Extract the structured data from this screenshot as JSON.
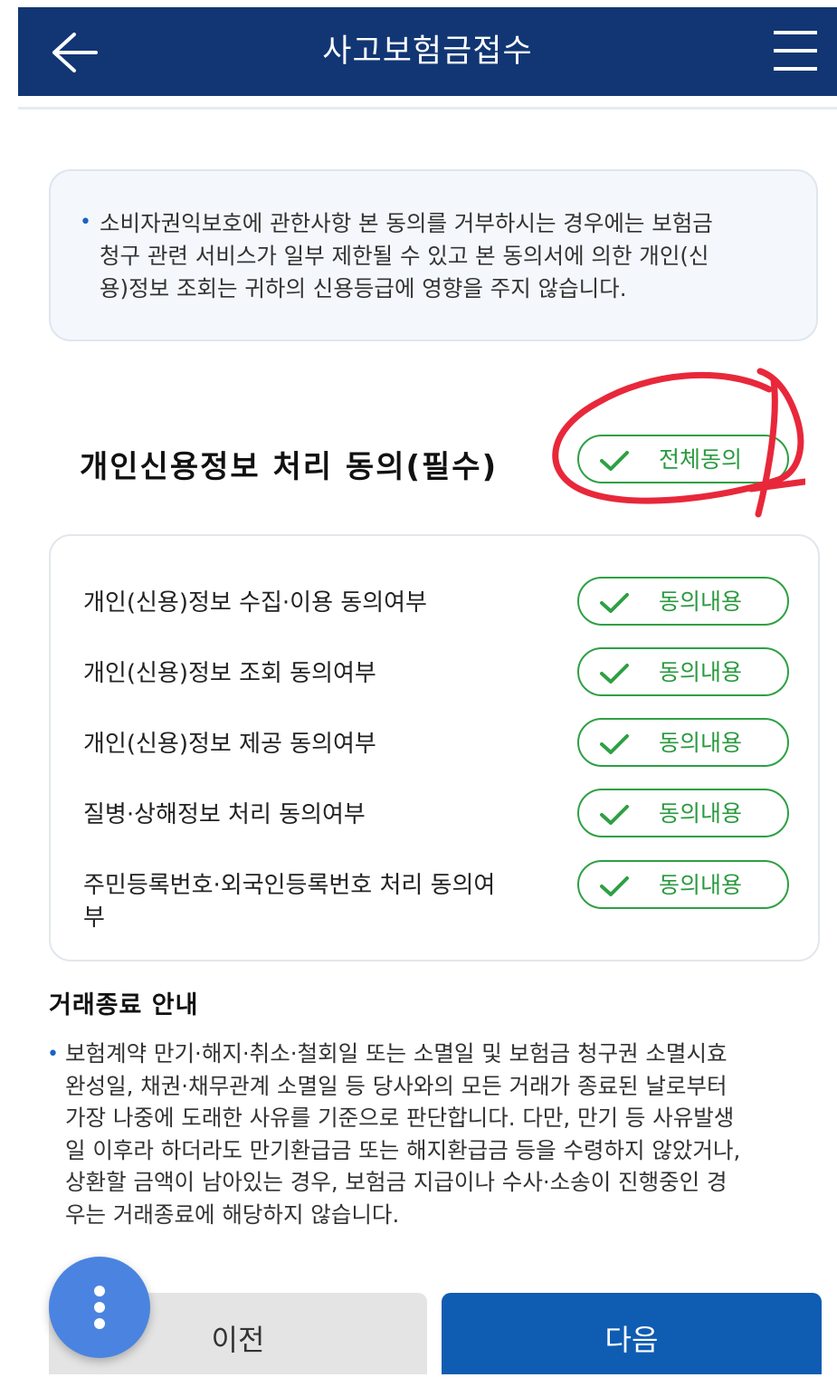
{
  "header": {
    "title": "사고보험금접수",
    "back_icon": "back-arrow-icon",
    "menu_icon": "hamburger-menu-icon",
    "background": "#113673"
  },
  "notice": {
    "line1": "소비자권익보호에 관한사항 본 동의를 거부하시는 경우에는 보험금",
    "line2": "청구 관련 서비스가 일부 제한될 수 있고 본 동의서에 의한 개인(신",
    "line3": "용)정보 조회는 귀하의 신용등급에 영향을 주지 않습니다."
  },
  "consent_section": {
    "title": "개인신용정보 처리 동의(필수)",
    "agree_all_label": "전체동의",
    "items": [
      {
        "label": "개인(신용)정보 수집·이용 동의여부",
        "button": "동의내용"
      },
      {
        "label": "개인(신용)정보 조회 동의여부",
        "button": "동의내용"
      },
      {
        "label": "개인(신용)정보 제공 동의여부",
        "button": "동의내용"
      },
      {
        "label": "질병·상해정보 처리 동의여부",
        "button": "동의내용"
      },
      {
        "label_line1": "주민등록번호·외국인등록번호 처리 동의여",
        "label_line2": "부",
        "button": "동의내용"
      }
    ],
    "check_color": "#2ea043"
  },
  "transaction_info": {
    "title": "거래종료 안내",
    "line1": "보험계약 만기·해지·취소·철회일 또는 소멸일 및 보험금 청구권 소멸시효",
    "line2": "완성일, 채권·채무관계 소멸일 등 당사와의 모든 거래가 종료된 날로부터",
    "line3": "가장 나중에 도래한 사유를 기준으로 판단합니다. 다만, 만기 등 사유발생",
    "line4": "일 이후라 하더라도 만기환급금 또는 해지환급금 등을 수령하지 않았거나,",
    "line5": "상환할 금액이 남아있는 경우, 보험금 지급이나 수사·소송이 진행중인 경",
    "line6": "우는 거래종료에 해당하지 않습니다."
  },
  "footer": {
    "prev_label": "이전",
    "next_label": "다음",
    "fab_icon": "more-vertical-icon",
    "next_color": "#0f5cb3"
  },
  "annotation_color": "#e8283a"
}
